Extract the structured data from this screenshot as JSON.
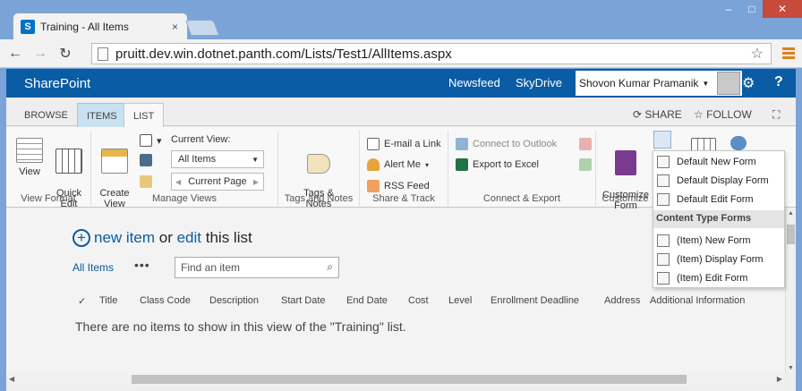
{
  "browser": {
    "tab_title": "Training - All Items",
    "tab_close": "×",
    "favicon": "S",
    "url": "pruitt.dev.win.dotnet.panth.com/Lists/Test1/AllItems.aspx",
    "window_controls": [
      "–",
      "□",
      "✕"
    ]
  },
  "sp_header": {
    "brand": "SharePoint",
    "links": [
      "Newsfeed",
      "SkyDrive"
    ],
    "user": "Shovon Kumar Pramanik",
    "help": "?"
  },
  "ribbon_tabs": [
    "BROWSE",
    "ITEMS",
    "LIST"
  ],
  "share": {
    "share": "SHARE",
    "follow": "FOLLOW"
  },
  "ribbon": {
    "view_format": {
      "view": "View",
      "quick_edit": "Quick\nEdit",
      "label": "View Format"
    },
    "manage_views": {
      "create_view": "Create\nView",
      "current_view_label": "Current View:",
      "current_view_value": "All Items",
      "current_page": "Current Page",
      "label": "Manage Views"
    },
    "tags": {
      "tags_notes": "Tags &\nNotes",
      "label": "Tags and Notes"
    },
    "share_track": {
      "email": "E-mail a Link",
      "alert": "Alert Me",
      "rss": "RSS Feed",
      "label": "Share & Track"
    },
    "connect_export": {
      "outlook": "Connect to Outlook",
      "excel": "Export to Excel",
      "label": "Connect & Export"
    },
    "customize": {
      "customize_form": "Customize\nForm",
      "label": "Customize"
    }
  },
  "content": {
    "new_item": "new item",
    "or": " or ",
    "edit": "edit",
    "this_list": " this list",
    "all_items": "All Items",
    "more": "•••",
    "find_placeholder": "Find an item",
    "columns": [
      "✓",
      "Title",
      "Class Code",
      "Description",
      "Start Date",
      "End Date",
      "Cost",
      "Level",
      "Enrollment Deadline",
      "Address",
      "Additional Information"
    ],
    "empty_message": "There are no items to show in this view of the \"Training\" list."
  },
  "form_menu": {
    "default_items": [
      "Default New Form",
      "Default Display Form",
      "Default Edit Form"
    ],
    "header": "Content Type Forms",
    "ct_items": [
      "(Item) New Form",
      "(Item) Display Form",
      "(Item) Edit Form"
    ]
  },
  "colors": {
    "sp_blue": "#0a5ca4",
    "ribbon_items_tab": "#c9e1f1",
    "accent_orange": "#e0801c"
  }
}
